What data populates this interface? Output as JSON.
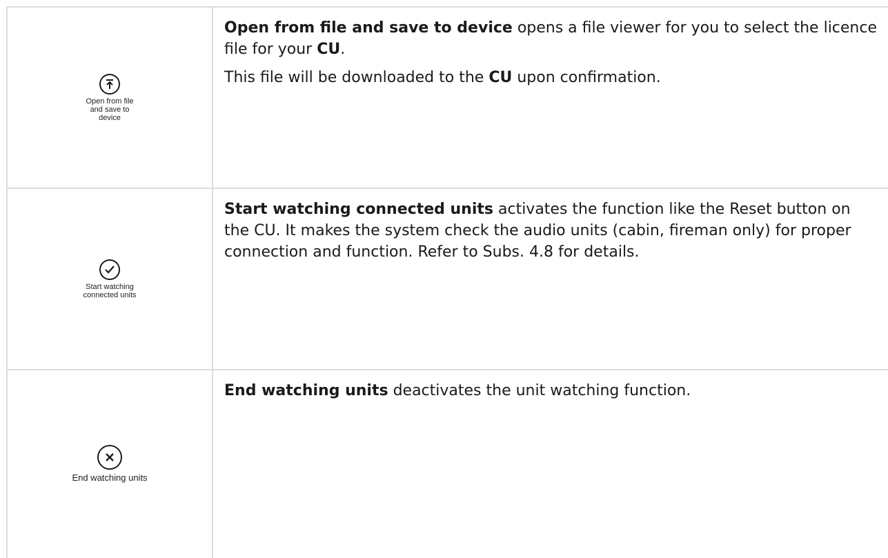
{
  "rows": [
    {
      "icon": "upload-icon",
      "caption": "Open from file and save to device",
      "paragraphs": [
        [
          "Open from file and save to device",
          " opens a file viewer for you to select the licence file for your ",
          "CU",
          "."
        ],
        [
          "This file will be downloaded to the ",
          "CU",
          " upon confirmation."
        ]
      ]
    },
    {
      "icon": "checkmark-circle-icon",
      "caption": "Start watching connected units",
      "paragraphs": [
        [
          "Start watching connected units",
          " activates the function like the Reset button on the CU. It makes the system check the audio units (cabin, fireman only) for proper connection and function. Refer to Subs. 4.8 for details."
        ]
      ]
    },
    {
      "icon": "close-circle-icon",
      "caption": "End watching units",
      "paragraphs": [
        [
          "End watching units",
          " deactivates the unit watching function."
        ]
      ]
    }
  ]
}
